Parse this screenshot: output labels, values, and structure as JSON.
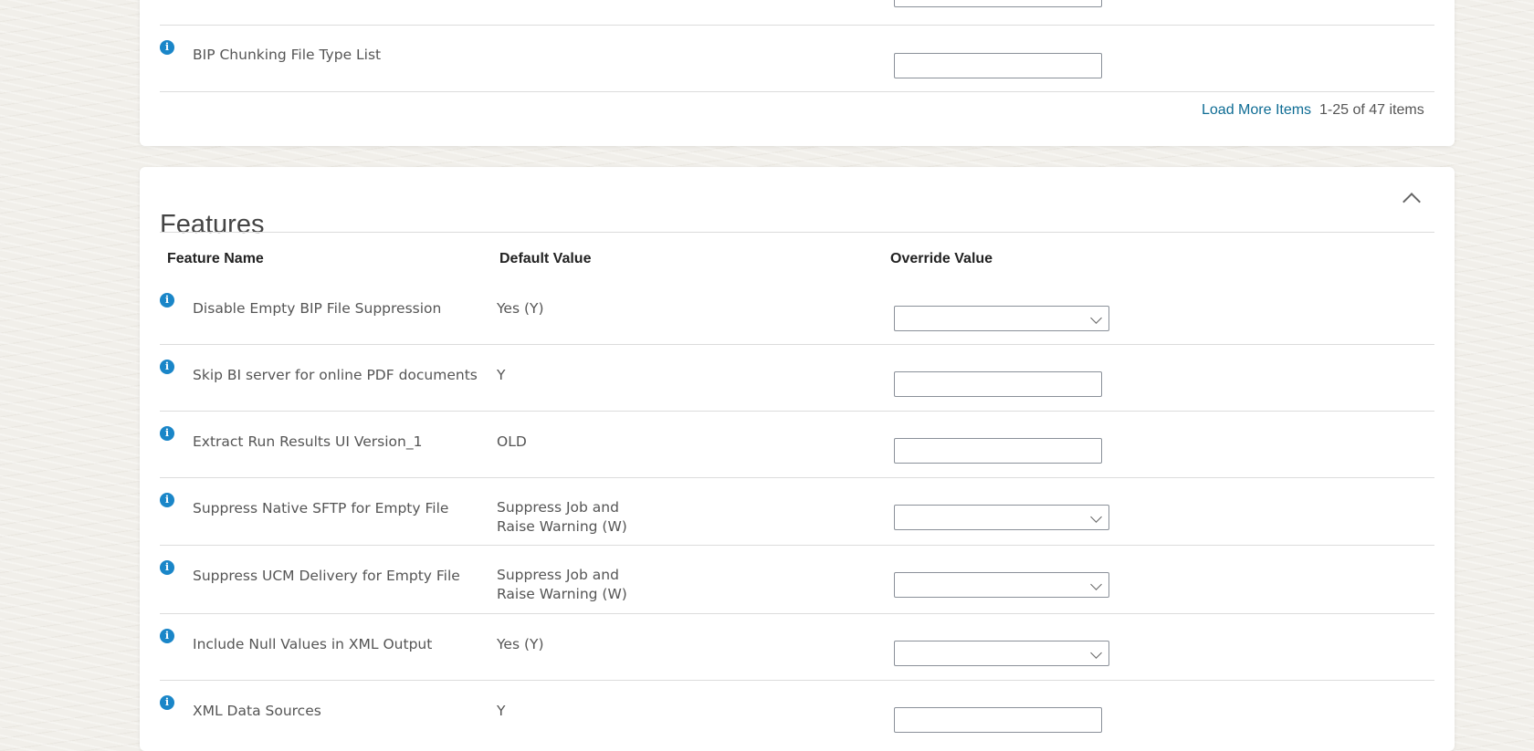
{
  "top_section": {
    "row_label": "BIP Chunking File Type List",
    "load_more": "Load More Items",
    "item_count": "1-25 of 47 items"
  },
  "features": {
    "title": "Features",
    "columns": [
      "Feature Name",
      "Default Value",
      "Override Value"
    ],
    "rows": [
      {
        "name": "Disable Empty BIP File Suppression",
        "default": "Yes (Y)",
        "default_line2": "",
        "override": "select"
      },
      {
        "name": "Skip BI server for online PDF documents",
        "default": "Y",
        "default_line2": "",
        "override": "text"
      },
      {
        "name": "Extract Run Results UI Version_1",
        "default": "OLD",
        "default_line2": "",
        "override": "text"
      },
      {
        "name": "Suppress Native SFTP for Empty File",
        "default": "Suppress Job and",
        "default_line2": "Raise Warning (W)",
        "override": "select"
      },
      {
        "name": "Suppress UCM Delivery for Empty File",
        "default": "Suppress Job and",
        "default_line2": "Raise Warning (W)",
        "override": "select"
      },
      {
        "name": "Include Null Values in XML Output",
        "default": "Yes (Y)",
        "default_line2": "",
        "override": "select"
      },
      {
        "name": "XML Data Sources",
        "default": "Y",
        "default_line2": "",
        "override": "text"
      }
    ]
  },
  "colors": {
    "info_icon": "#1a86c8",
    "link": "#0e6c94"
  }
}
